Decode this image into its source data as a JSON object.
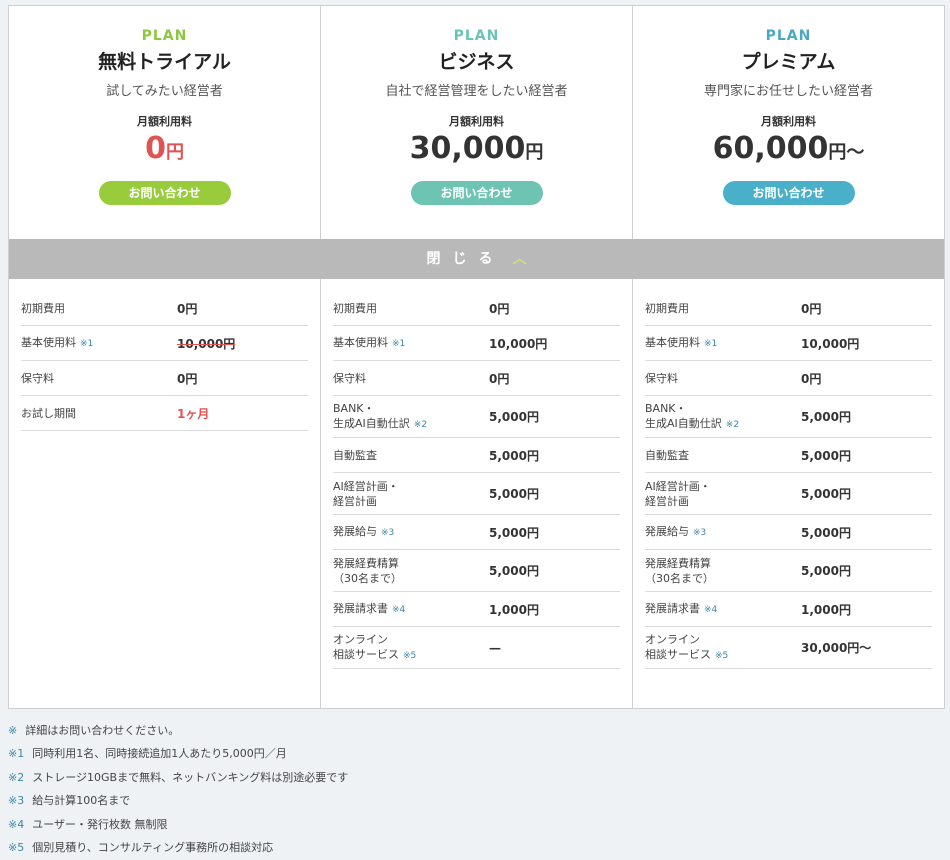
{
  "plans": [
    {
      "tag": "PLAN",
      "tag_color": "#8dc63f",
      "name": "無料トライアル",
      "sub": "試してみたい経営者",
      "fee_label": "月額利用料",
      "price_num": "0",
      "price_unit": "円",
      "price_red": true,
      "button": "お問い合わせ",
      "button_color": "#99cc3d",
      "rows": [
        {
          "label": "初期費用",
          "note": "",
          "value": "0円"
        },
        {
          "label": "基本使用料",
          "note": "※1",
          "value": "10,000円",
          "strike": true
        },
        {
          "label": "保守料",
          "note": "",
          "value": "0円"
        },
        {
          "label": "お試し期間",
          "note": "",
          "value": "1ヶ月",
          "red": true
        }
      ]
    },
    {
      "tag": "PLAN",
      "tag_color": "#6ac3b4",
      "name": "ビジネス",
      "sub": "自社で経営管理をしたい経営者",
      "fee_label": "月額利用料",
      "price_num": "30,000",
      "price_unit": "円",
      "price_red": false,
      "button": "お問い合わせ",
      "button_color": "#6dc4b2",
      "rows": [
        {
          "label": "初期費用",
          "note": "",
          "value": "0円"
        },
        {
          "label": "基本使用料",
          "note": "※1",
          "value": "10,000円"
        },
        {
          "label": "保守料",
          "note": "",
          "value": "0円"
        },
        {
          "label": "BANK・\n生成AI自動仕訳",
          "note": "※2",
          "value": "5,000円"
        },
        {
          "label": "自動監査",
          "note": "",
          "value": "5,000円"
        },
        {
          "label": "AI経営計画・\n経営計画",
          "note": "",
          "value": "5,000円"
        },
        {
          "label": "発展給与",
          "note": "※3",
          "value": "5,000円"
        },
        {
          "label": "発展経費精算\n（30名まで）",
          "note": "",
          "value": "5,000円"
        },
        {
          "label": "発展請求書",
          "note": "※4",
          "value": "1,000円"
        },
        {
          "label": "オンライン\n相談サービス",
          "note": "※5",
          "value": "—"
        }
      ]
    },
    {
      "tag": "PLAN",
      "tag_color": "#4aa8c4",
      "name": "プレミアム",
      "sub": "専門家にお任せしたい経営者",
      "fee_label": "月額利用料",
      "price_num": "60,000",
      "price_unit": "円〜",
      "price_red": false,
      "button": "お問い合わせ",
      "button_color": "#4aafc8",
      "rows": [
        {
          "label": "初期費用",
          "note": "",
          "value": "0円"
        },
        {
          "label": "基本使用料",
          "note": "※1",
          "value": "10,000円"
        },
        {
          "label": "保守料",
          "note": "",
          "value": "0円"
        },
        {
          "label": "BANK・\n生成AI自動仕訳",
          "note": "※2",
          "value": "5,000円"
        },
        {
          "label": "自動監査",
          "note": "",
          "value": "5,000円"
        },
        {
          "label": "AI経営計画・\n経営計画",
          "note": "",
          "value": "5,000円"
        },
        {
          "label": "発展給与",
          "note": "※3",
          "value": "5,000円"
        },
        {
          "label": "発展経費精算\n（30名まで）",
          "note": "",
          "value": "5,000円"
        },
        {
          "label": "発展請求書",
          "note": "※4",
          "value": "1,000円"
        },
        {
          "label": "オンライン\n相談サービス",
          "note": "※5",
          "value": "30,000円〜"
        }
      ]
    }
  ],
  "toggle": {
    "label": "閉じる",
    "icon": "chevron-up-icon"
  },
  "notes": [
    {
      "mark": "※",
      "text": "詳細はお問い合わせください。"
    },
    {
      "mark": "※1",
      "text": "同時利用1名、同時接続追加1人あたり5,000円／月"
    },
    {
      "mark": "※2",
      "text": "ストレージ10GBまで無料、ネットバンキング料は別途必要です"
    },
    {
      "mark": "※3",
      "text": "給与計算100名まで"
    },
    {
      "mark": "※4",
      "text": "ユーザー・発行枚数 無制限"
    },
    {
      "mark": "※5",
      "text": "個別見積り、コンサルティング事務所の相談対応"
    }
  ]
}
